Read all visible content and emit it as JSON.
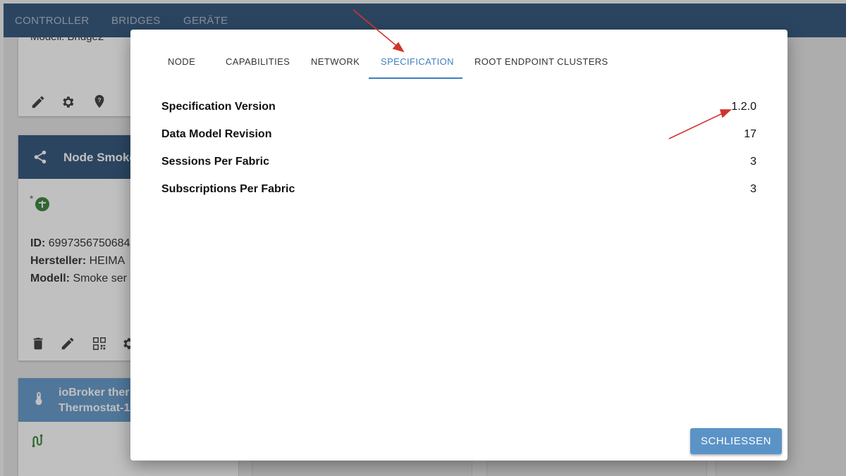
{
  "appbar": {
    "tabs": [
      "CONTROLLER",
      "BRIDGES",
      "GERÄTE"
    ]
  },
  "background": {
    "top_card_text": "Modell: Bridge2",
    "smoke_card": {
      "title": "Node Smoke",
      "id_label": "ID:",
      "id_value": "6997356750684",
      "manufacturer_label": "Hersteller:",
      "manufacturer_value": "HEIMA",
      "model_label": "Modell:",
      "model_value": "Smoke ser"
    },
    "thermo_card": {
      "title_line1": "ioBroker ther",
      "title_line2": "Thermostat-1"
    }
  },
  "dialog": {
    "tabs": [
      {
        "label": "NODE"
      },
      {
        "label": "CAPABILITIES"
      },
      {
        "label": "NETWORK"
      },
      {
        "label": "SPECIFICATION",
        "active": true
      },
      {
        "label": "ROOT ENDPOINT CLUSTERS"
      }
    ],
    "rows": [
      {
        "key": "Specification Version",
        "value": "1.2.0"
      },
      {
        "key": "Data Model Revision",
        "value": "17"
      },
      {
        "key": "Sessions Per Fabric",
        "value": "3"
      },
      {
        "key": "Subscriptions Per Fabric",
        "value": "3"
      }
    ],
    "close_label": "SCHLIESSEN"
  },
  "colors": {
    "appbar": "#244a73",
    "accent": "#3f7fbf",
    "button": "#5b93c7",
    "annotation_arrow": "#d0342c",
    "icon_green": "#2e7d32"
  },
  "icons": [
    "pencil-icon",
    "gear-icon",
    "location-help-icon",
    "share-node-icon",
    "matter-icon",
    "trash-icon",
    "qr-code-icon",
    "thermometer-icon",
    "connection-icon"
  ]
}
